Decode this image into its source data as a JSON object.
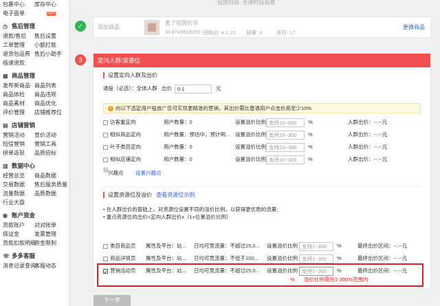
{
  "sidebar": {
    "top_rows": [
      [
        "包裹中心",
        "库存中心"
      ],
      [
        "电子面单",
        ""
      ]
    ],
    "top_hot": "HOT",
    "sections": [
      {
        "title": "售后管理",
        "rows": [
          [
            "退款/售后",
            "售后设置"
          ],
          [
            "工单管理",
            "小额打款"
          ],
          [
            "退货包运费",
            "售后小助手"
          ],
          [
            "极速退款",
            ""
          ]
        ]
      },
      {
        "title": "商品管理",
        "rows": [
          [
            "发布新商品",
            "商品列表"
          ],
          [
            "商品体检",
            "商品违规"
          ],
          [
            "商品素材",
            "商品优化"
          ],
          [
            "评价管理",
            "店铺推荐位"
          ]
        ]
      },
      {
        "title": "店铺营销",
        "rows": [
          [
            "营销活动",
            "竞价活动"
          ],
          [
            "短信营销",
            "营销工具"
          ],
          [
            "拼单返现",
            "品质招标"
          ]
        ]
      },
      {
        "title": "数据中心",
        "rows": [
          [
            "经营总览",
            "商品数据"
          ],
          [
            "交易数据",
            "售后服务质量"
          ],
          [
            "流量数据",
            "品质数据"
          ],
          [
            "行业大盘",
            ""
          ]
        ]
      },
      {
        "title": "账户资金",
        "rows": [
          [
            "货款账户",
            "对对账单"
          ],
          [
            "保证金",
            "发票管理"
          ],
          [
            "货款扣款明细",
            "资金限制"
          ]
        ]
      },
      {
        "title": "多多客服",
        "rows": [
          [
            "消息记录查询",
            "客服动态"
          ]
        ]
      }
    ]
  },
  "header_faint": "投放时段: 全弹时段投放",
  "step1": {
    "label": "添加商品",
    "product_name": "麦了就困的书",
    "id_text": "ID:4749518059",
    "group_price": "团购价: ¥ 1.20",
    "sales": "销量: 4",
    "stock": "库存: 17",
    "change_link": "更换商品"
  },
  "step3": {
    "number": "3",
    "header": "定向人群/资源位",
    "section1_title": "设置定向人群及出价",
    "bid_label": "通投（必选）：全体人群",
    "bid_prefix": "出价",
    "bid_value": "0.1",
    "bid_unit": "元",
    "warning": "向以下选定用户投放广告可实现更精准的营销，其出价需比普通用户点击价高至少10%",
    "audiences": [
      {
        "name": "访客重定向",
        "users": "用户数量：0",
        "ratio_label": "设置溢价比例",
        "placeholder": "支持10~300",
        "pct": "%",
        "bid": "人群出价：--.--元"
      },
      {
        "name": "相似商品定向",
        "users": "用户数量：预估中，预计明...",
        "ratio_label": "设置溢价比例",
        "placeholder": "支持10~300",
        "pct": "%",
        "bid": "人群出价：--.--元"
      },
      {
        "name": "叶子类目定向",
        "users": "用户数量：0",
        "ratio_label": "设置溢价比例",
        "placeholder": "支持10~300",
        "pct": "%",
        "bid": "人群出价：--.--元"
      },
      {
        "name": "相似店铺定向",
        "users": "用户数量：0",
        "ratio_label": "设置溢价比例",
        "placeholder": "支持10~300",
        "pct": "%",
        "bid": "人群出价：--.--元"
      }
    ],
    "interest_label": "兴趣点",
    "interest_link": "设置兴趣点",
    "section2_title": "设置资源位及溢价",
    "section2_link": "查看资源位示例",
    "bullets": [
      "在人群出价的基础上，对资源位设置不同的溢价比例，以获得更优质的流量;",
      "重点资源位的出价=定向人群出价x（1+位置溢价比例）"
    ],
    "resources": [
      {
        "name": "类目商品页",
        "attr": "属性及平台：站...",
        "traffic": "日均可竞流量：不超过25,0...",
        "ratio_label": "设置溢价比例",
        "placeholder": "支持1~300",
        "pct": "%",
        "bid": "最终出价区间：--.--元",
        "checked": false
      },
      {
        "name": "商品详情页",
        "attr": "属性及平台：站...",
        "traffic": "日均可竞流量：不低于100...",
        "ratio_label": "设置溢价比例",
        "placeholder": "支持1~300",
        "pct": "%",
        "bid": "最终出价区间：--.--元",
        "checked": false
      },
      {
        "name": "营销活动页",
        "attr": "属性及平台：站...",
        "traffic": "日均可竞流量：不超过25,0...",
        "ratio_label": "设置溢价比例",
        "placeholder": "支持1~300",
        "pct": "%",
        "bid": "最终出价区间：--.--元",
        "checked": true
      }
    ],
    "error_pct": "%",
    "error_text": "溢价比例需在1-300%范围内"
  },
  "next_button": "下一步",
  "colors": {
    "accent": "#f05050",
    "success": "#2db84d",
    "link": "#3366cc",
    "error": "#e02020",
    "highlight_border": "#e02020"
  }
}
